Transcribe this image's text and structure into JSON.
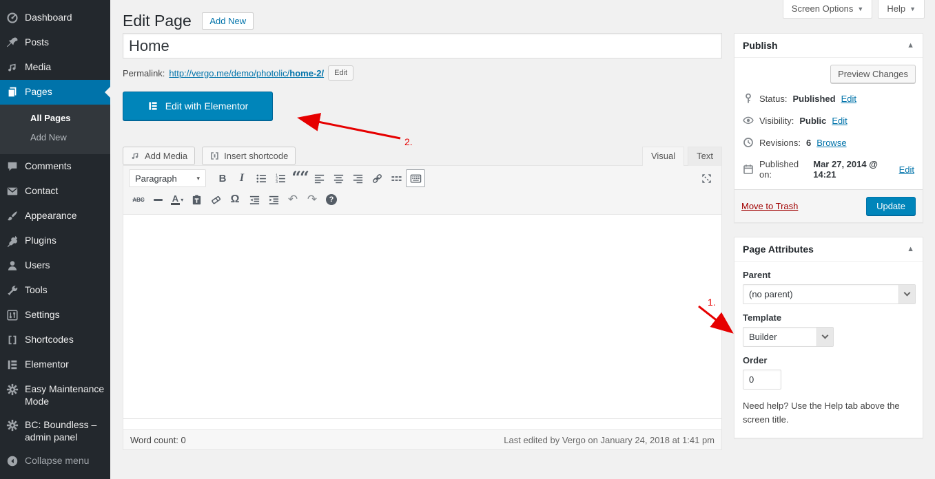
{
  "header": {
    "title": "Edit Page",
    "add_new_button": "Add New",
    "screen_options": "Screen Options",
    "help": "Help"
  },
  "sidebar": {
    "items": [
      {
        "label": "Dashboard",
        "icon": "dashboard-icon"
      },
      {
        "label": "Posts",
        "icon": "pushpin-icon"
      },
      {
        "label": "Media",
        "icon": "media-icon"
      },
      {
        "label": "Pages",
        "icon": "pages-icon"
      },
      {
        "label": "Comments",
        "icon": "comment-icon"
      },
      {
        "label": "Contact",
        "icon": "envelope-icon"
      },
      {
        "label": "Appearance",
        "icon": "brush-icon"
      },
      {
        "label": "Plugins",
        "icon": "plug-icon"
      },
      {
        "label": "Users",
        "icon": "user-icon"
      },
      {
        "label": "Tools",
        "icon": "wrench-icon"
      },
      {
        "label": "Settings",
        "icon": "sliders-icon"
      },
      {
        "label": "Shortcodes",
        "icon": "brackets-icon"
      },
      {
        "label": "Elementor",
        "icon": "elementor-icon"
      },
      {
        "label": "Easy Maintenance Mode",
        "icon": "gear-icon"
      },
      {
        "label": "BC: Boundless – admin panel",
        "icon": "gear-icon"
      },
      {
        "label": "Collapse menu",
        "icon": "collapse-icon"
      }
    ],
    "submenu": [
      {
        "label": "All Pages",
        "current": true
      },
      {
        "label": "Add New",
        "current": false
      }
    ]
  },
  "post": {
    "title_value": "Home",
    "permalink_label": "Permalink:",
    "permalink_base": "http://vergo.me/demo/photolic/",
    "permalink_slug": "home-2/",
    "permalink_edit_button": "Edit",
    "elementor_button": "Edit with Elementor"
  },
  "editor": {
    "add_media_button": "Add Media",
    "insert_shortcode_button": "Insert shortcode",
    "visual_tab": "Visual",
    "text_tab": "Text",
    "paragraph_dropdown": "Paragraph",
    "toolbar_row1": [
      "paragraph-select",
      "bold",
      "italic",
      "bullet-list",
      "ordered-list",
      "blockquote",
      "align-left",
      "align-center",
      "align-right",
      "link",
      "read-more",
      "toolbar-toggle",
      "fullscreen"
    ],
    "toolbar_row2": [
      "strikethrough",
      "horizontal-rule",
      "text-color",
      "paste-as-text",
      "clear-formatting",
      "special-character",
      "outdent",
      "indent",
      "undo",
      "redo",
      "help"
    ],
    "glyphs": {
      "bold": "B",
      "italic": "I",
      "blockquote": "““",
      "strikethrough": "ABC",
      "text_color": "A",
      "omega": "Ω",
      "undo": "↶",
      "redo": "↷",
      "help": "?"
    },
    "statusbar": {
      "word_count_label": "Word count:",
      "word_count_value": "0",
      "last_edited": "Last edited by Vergo on January 24, 2018 at 1:41 pm"
    }
  },
  "publish": {
    "title": "Publish",
    "preview_button": "Preview Changes",
    "rows": [
      {
        "label": "Status:",
        "value": "Published",
        "action": "Edit",
        "icon": "pin-icon"
      },
      {
        "label": "Visibility:",
        "value": "Public",
        "action": "Edit",
        "icon": "eye-icon"
      },
      {
        "label": "Revisions:",
        "value": "6",
        "action": "Browse",
        "icon": "history-icon"
      },
      {
        "label": "Published on:",
        "value": "Mar 27, 2014 @ 14:21",
        "action": "Edit",
        "icon": "calendar-icon"
      }
    ],
    "move_to_trash": "Move to Trash",
    "update_button": "Update"
  },
  "page_attributes": {
    "title": "Page Attributes",
    "parent_label": "Parent",
    "parent_value": "(no parent)",
    "template_label": "Template",
    "template_value": "Builder",
    "order_label": "Order",
    "order_value": "0",
    "help_text": "Need help? Use the Help tab above the screen title."
  },
  "annotations": {
    "step1": "1.",
    "step2": "2."
  },
  "icons": {
    "caret_down": "▾",
    "caret_down_small": "▼",
    "toggle_up": "▲"
  },
  "colors": {
    "accent_blue": "#0073aa",
    "primary_button": "#0085ba",
    "sidebar_bg": "#23282d",
    "submenu_bg": "#32373c",
    "active_item_bg": "#0073aa",
    "page_bg": "#f1f1f1",
    "annotation_red": "#e60000",
    "trash_link_red": "#a00000"
  }
}
